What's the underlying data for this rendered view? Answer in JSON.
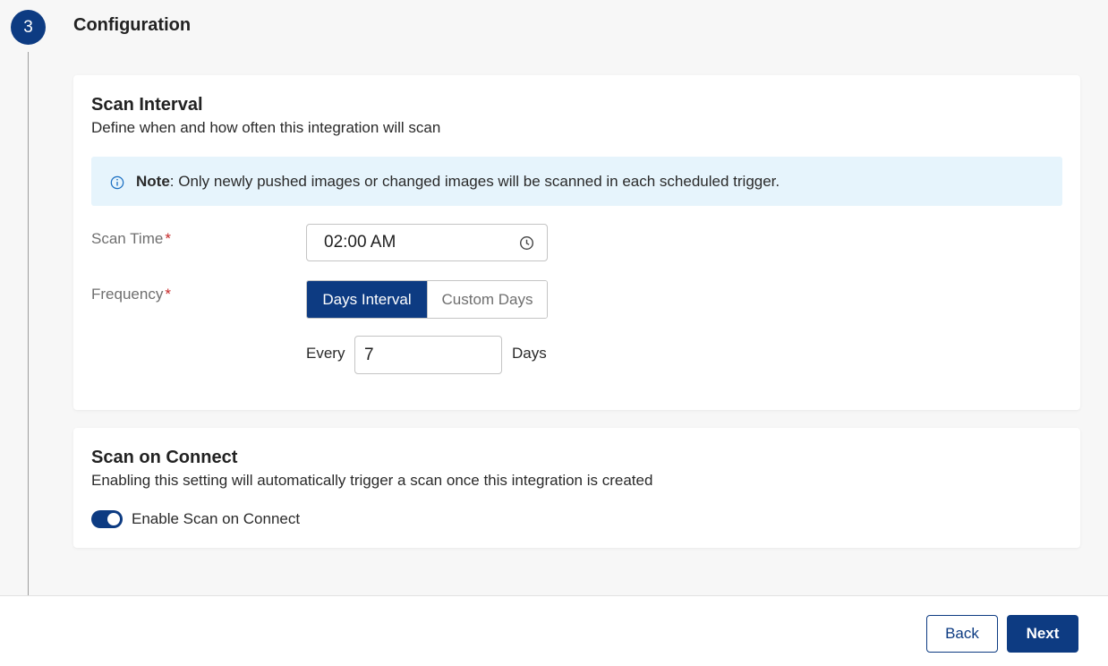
{
  "step": {
    "number": "3",
    "title": "Configuration"
  },
  "scan_interval": {
    "title": "Scan Interval",
    "description": "Define when and how often this integration will scan",
    "note_label": "Note",
    "note_text": ": Only newly pushed images or changed images will be scanned in each scheduled trigger.",
    "scan_time": {
      "label": "Scan Time",
      "required_mark": "*",
      "value": "02:00 AM",
      "icon": "clock-icon"
    },
    "frequency": {
      "label": "Frequency",
      "required_mark": "*",
      "options": [
        "Days Interval",
        "Custom Days"
      ],
      "selected": "Days Interval"
    },
    "interval": {
      "prefix": "Every",
      "value": "7",
      "suffix": "Days"
    }
  },
  "scan_on_connect": {
    "title": "Scan on Connect",
    "description": "Enabling this setting will automatically trigger a scan once this integration is created",
    "toggle_label": "Enable Scan on Connect",
    "toggle_on": true
  },
  "footer": {
    "back_label": "Back",
    "next_label": "Next"
  },
  "colors": {
    "primary": "#0d3b82",
    "note_bg": "#e6f4fc",
    "required": "#c62828"
  }
}
